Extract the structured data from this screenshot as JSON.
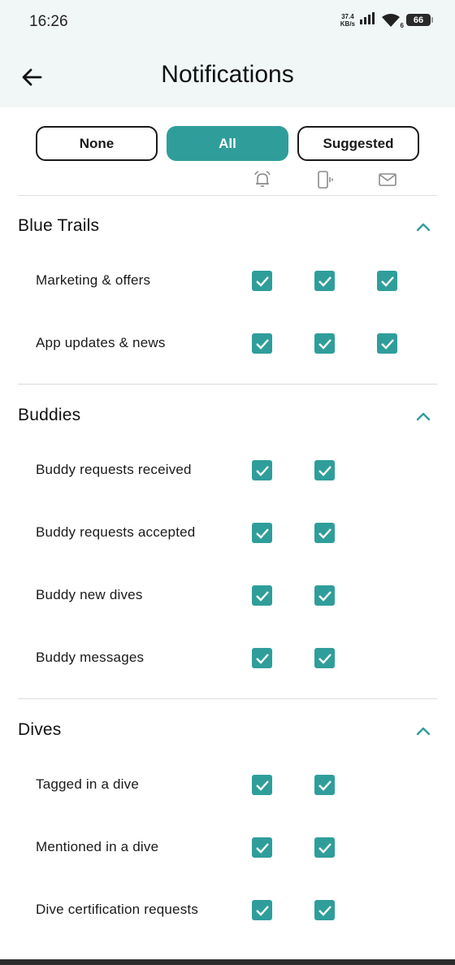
{
  "status_bar": {
    "time": "16:26",
    "speed_value": "37.4",
    "speed_unit": "KB/s",
    "wifi_badge": "6",
    "battery": "66"
  },
  "header": {
    "title": "Notifications",
    "back_icon": "arrow-left-icon"
  },
  "presets": {
    "none": "None",
    "all": "All",
    "suggested": "Suggested",
    "selected": "All"
  },
  "channels": [
    "bell-icon",
    "phone-vibrate-icon",
    "mail-icon"
  ],
  "colors": {
    "accent": "#2f9e9b",
    "header_bg": "#f1f7f7",
    "divider": "#dcdcdc"
  },
  "sections": [
    {
      "title": "Blue Trails",
      "expanded": true,
      "rows": [
        {
          "label": "Marketing & offers",
          "push": true,
          "in_app": true,
          "email": true
        },
        {
          "label": "App updates & news",
          "push": true,
          "in_app": true,
          "email": true
        }
      ]
    },
    {
      "title": "Buddies",
      "expanded": true,
      "rows": [
        {
          "label": "Buddy requests received",
          "push": true,
          "in_app": true
        },
        {
          "label": "Buddy requests accepted",
          "push": true,
          "in_app": true
        },
        {
          "label": "Buddy new dives",
          "push": true,
          "in_app": true
        },
        {
          "label": "Buddy messages",
          "push": true,
          "in_app": true
        }
      ]
    },
    {
      "title": "Dives",
      "expanded": true,
      "rows": [
        {
          "label": "Tagged in a dive",
          "push": true,
          "in_app": true
        },
        {
          "label": "Mentioned in a dive",
          "push": true,
          "in_app": true
        },
        {
          "label": "Dive certification requests",
          "push": true,
          "in_app": true
        }
      ]
    }
  ]
}
